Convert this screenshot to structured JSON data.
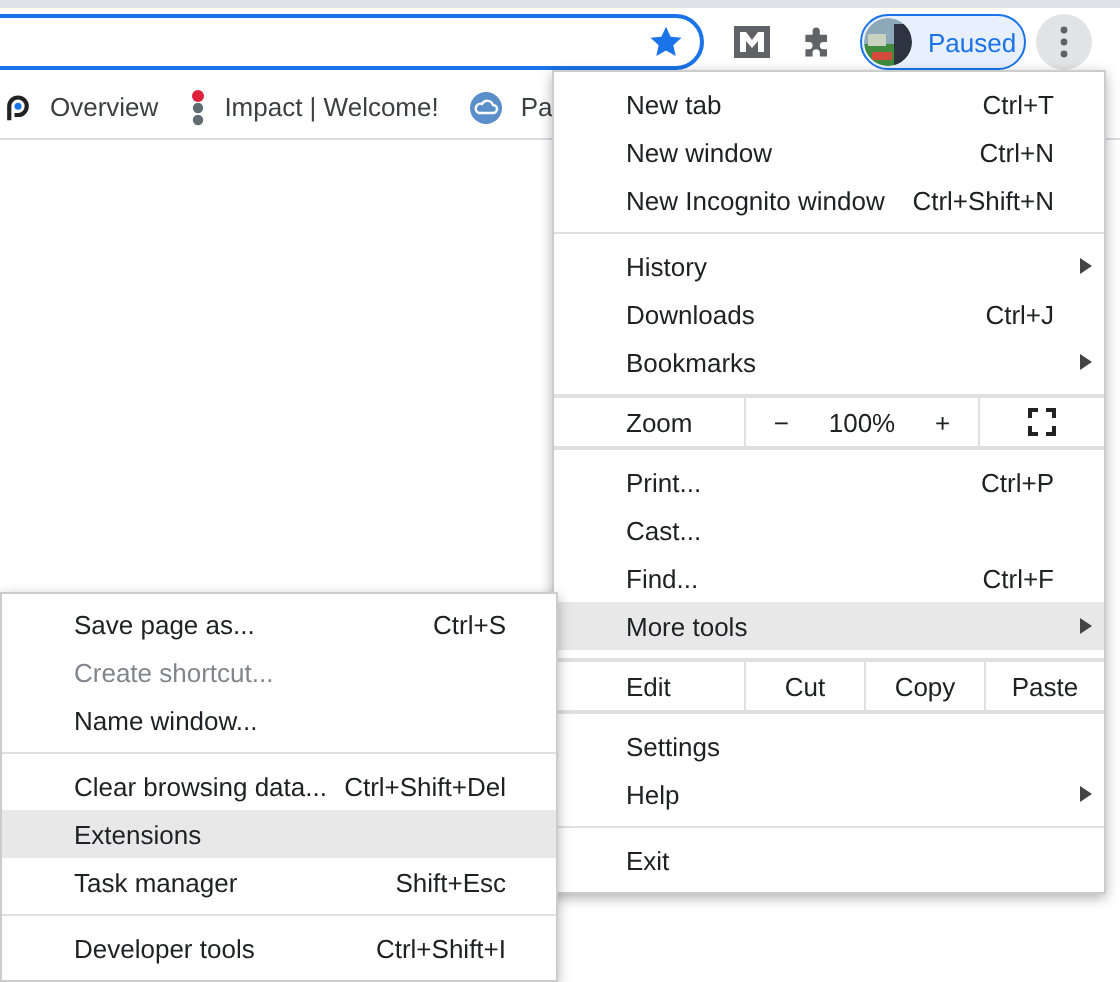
{
  "toolbar": {
    "chip_label": "Paused"
  },
  "bookmarks": [
    {
      "label": "Overview",
      "kind": "p"
    },
    {
      "label": "Impact | Welcome!",
      "kind": "dots"
    },
    {
      "label": "Pa",
      "kind": "cloud"
    }
  ],
  "menu": {
    "items": [
      {
        "kind": "item",
        "label": "New tab",
        "shortcut": "Ctrl+T",
        "submenu": false,
        "highlighted": false,
        "disabled": false
      },
      {
        "kind": "item",
        "label": "New window",
        "shortcut": "Ctrl+N",
        "submenu": false,
        "highlighted": false,
        "disabled": false
      },
      {
        "kind": "item",
        "label": "New Incognito window",
        "shortcut": "Ctrl+Shift+N",
        "submenu": false,
        "highlighted": false,
        "disabled": false
      },
      {
        "kind": "separator"
      },
      {
        "kind": "item",
        "label": "History",
        "submenu": true,
        "highlighted": false,
        "disabled": false
      },
      {
        "kind": "item",
        "label": "Downloads",
        "shortcut": "Ctrl+J",
        "submenu": false,
        "highlighted": false,
        "disabled": false
      },
      {
        "kind": "item",
        "label": "Bookmarks",
        "submenu": true,
        "highlighted": false,
        "disabled": false
      },
      {
        "kind": "separator"
      },
      {
        "kind": "zoom",
        "label": "Zoom",
        "minus": "−",
        "value": "100%",
        "plus": "+"
      },
      {
        "kind": "separator"
      },
      {
        "kind": "item",
        "label": "Print...",
        "shortcut": "Ctrl+P",
        "submenu": false,
        "highlighted": false,
        "disabled": false
      },
      {
        "kind": "item",
        "label": "Cast...",
        "submenu": false,
        "highlighted": false,
        "disabled": false
      },
      {
        "kind": "item",
        "label": "Find...",
        "shortcut": "Ctrl+F",
        "submenu": false,
        "highlighted": false,
        "disabled": false
      },
      {
        "kind": "item",
        "label": "More tools",
        "submenu": true,
        "highlighted": true,
        "disabled": false
      },
      {
        "kind": "separator"
      },
      {
        "kind": "edit",
        "label": "Edit",
        "buttons": [
          "Cut",
          "Copy",
          "Paste"
        ]
      },
      {
        "kind": "separator"
      },
      {
        "kind": "item",
        "label": "Settings",
        "submenu": false,
        "highlighted": false,
        "disabled": false
      },
      {
        "kind": "item",
        "label": "Help",
        "submenu": true,
        "highlighted": false,
        "disabled": false
      },
      {
        "kind": "separator"
      },
      {
        "kind": "item",
        "label": "Exit",
        "submenu": false,
        "highlighted": false,
        "disabled": false
      }
    ]
  },
  "submenu": {
    "items": [
      {
        "kind": "item",
        "label": "Save page as...",
        "shortcut": "Ctrl+S",
        "highlighted": false,
        "disabled": false
      },
      {
        "kind": "item",
        "label": "Create shortcut...",
        "highlighted": false,
        "disabled": true
      },
      {
        "kind": "item",
        "label": "Name window...",
        "highlighted": false,
        "disabled": false
      },
      {
        "kind": "separator"
      },
      {
        "kind": "item",
        "label": "Clear browsing data...",
        "shortcut": "Ctrl+Shift+Del",
        "highlighted": false,
        "disabled": false
      },
      {
        "kind": "item",
        "label": "Extensions",
        "highlighted": true,
        "disabled": false
      },
      {
        "kind": "item",
        "label": "Task manager",
        "shortcut": "Shift+Esc",
        "highlighted": false,
        "disabled": false
      },
      {
        "kind": "separator"
      },
      {
        "kind": "item",
        "label": "Developer tools",
        "shortcut": "Ctrl+Shift+I",
        "highlighted": false,
        "disabled": false
      }
    ]
  }
}
